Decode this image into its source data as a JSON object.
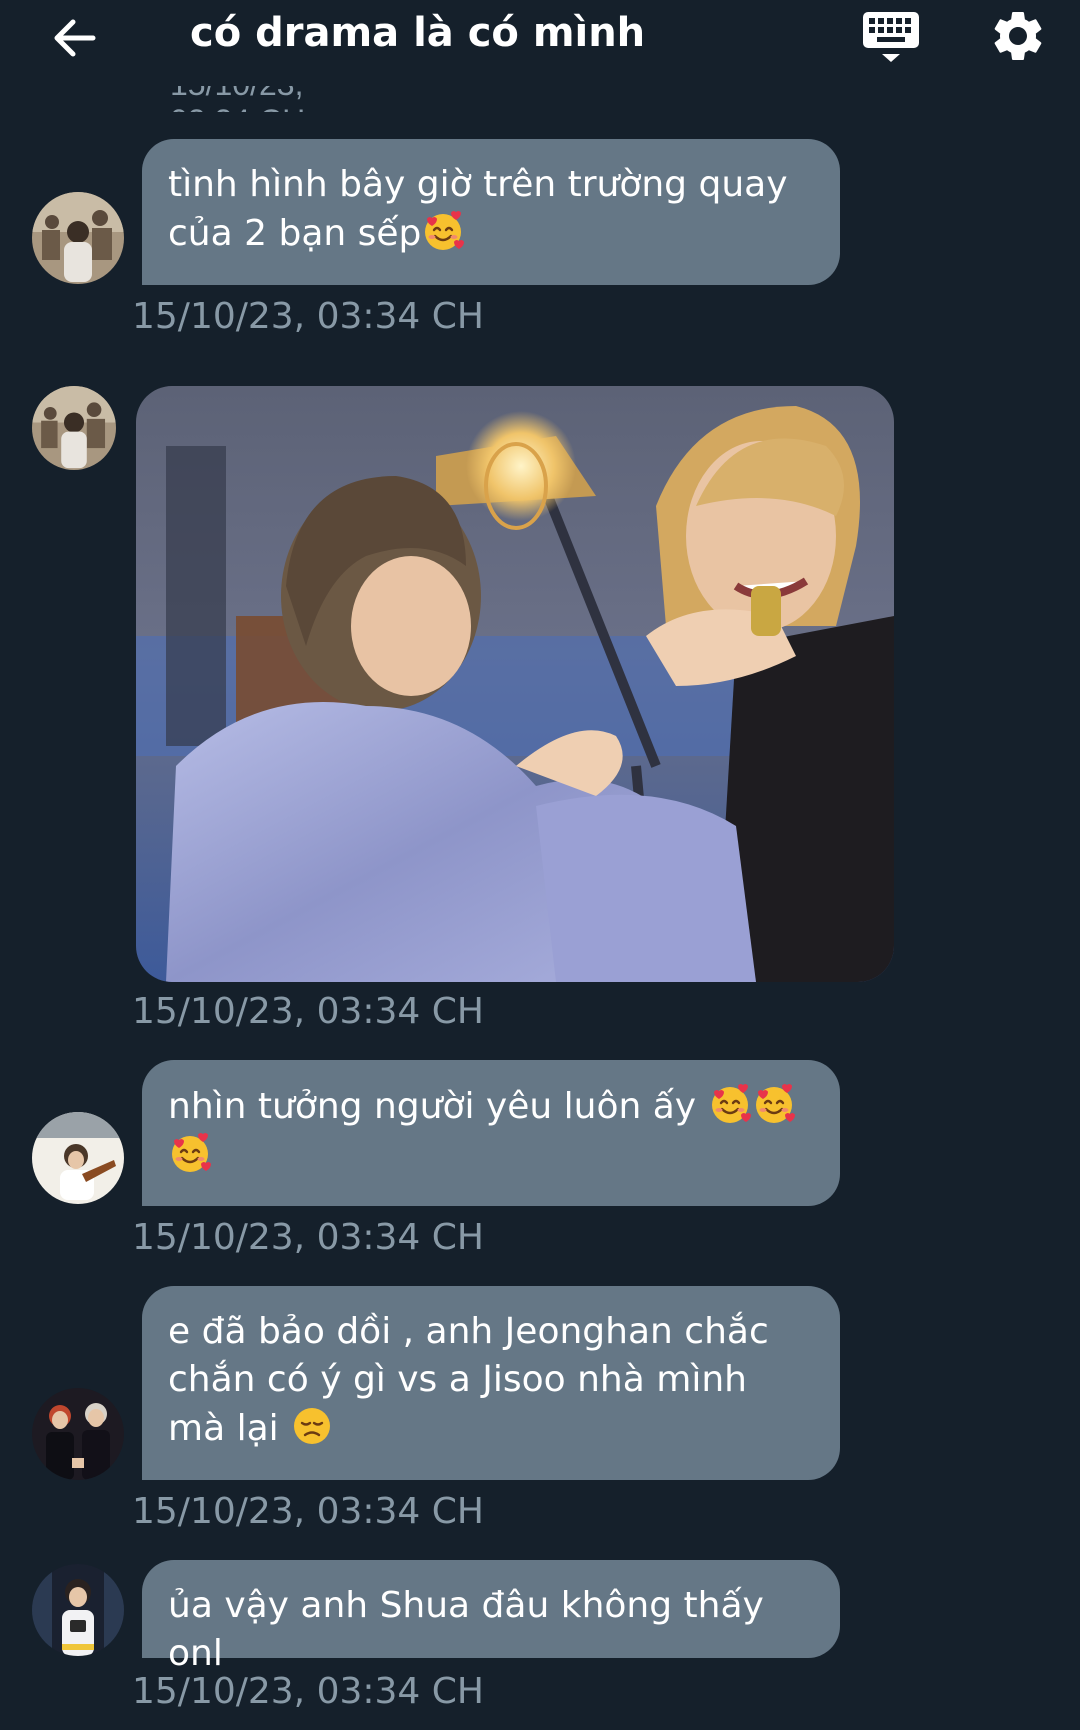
{
  "header": {
    "title": "có drama là có mình",
    "back_icon": "arrow-left-icon",
    "keyboard_icon": "keyboard-icon",
    "settings_icon": "gear-icon"
  },
  "colors": {
    "background": "#15202b",
    "bubble": "#657786",
    "timestamp": "#8899a6",
    "text": "#ffffff"
  },
  "messages": [
    {
      "text": "tình hình bây giờ trên trường quay của 2 bạn sếp",
      "emoji": [
        "smiling-face-with-hearts-icon"
      ],
      "timestamp": "15/10/23, 03:34 CH"
    },
    {
      "type": "photo",
      "timestamp": "15/10/23, 03:34 CH"
    },
    {
      "text": "nhìn tưởng người yêu luôn ấy",
      "emoji": [
        "smiling-face-with-hearts-icon",
        "smiling-face-with-hearts-icon",
        "smiling-face-with-hearts-icon"
      ],
      "timestamp": "15/10/23, 03:34 CH"
    },
    {
      "text": "e đã bảo dồi , anh Jeonghan chắc chắn có ý gì vs a Jisoo nhà mình mà lại",
      "emoji": [
        "disappointed-face-icon"
      ],
      "timestamp": "15/10/23, 03:34 CH"
    },
    {
      "text": "ủa vậy anh Shua đâu không thấy onl",
      "timestamp": "15/10/23, 03:34 CH"
    }
  ]
}
